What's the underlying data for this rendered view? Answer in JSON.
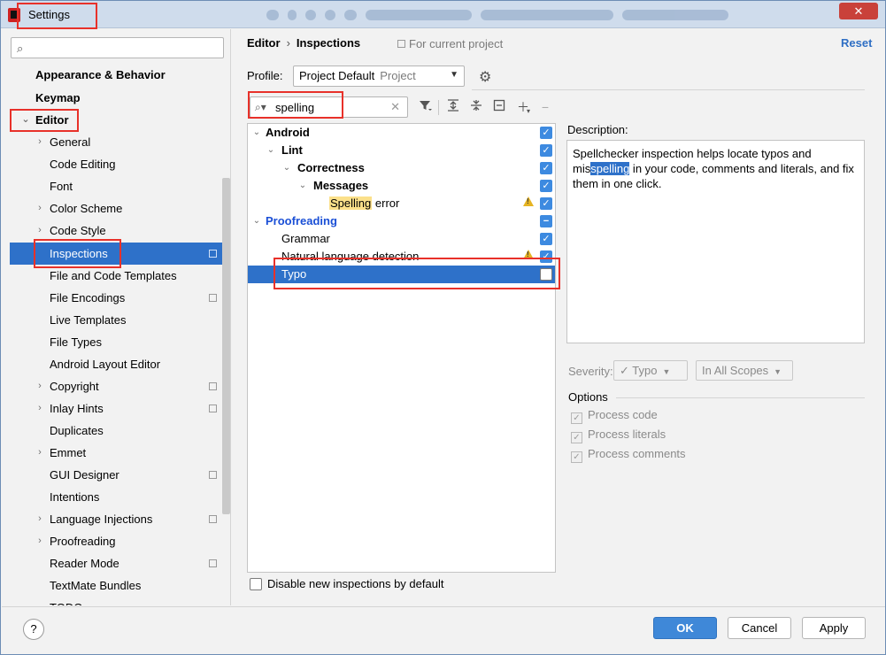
{
  "window": {
    "title": "Settings",
    "close": "✕"
  },
  "sidebar": {
    "search_placeholder": "",
    "items": [
      {
        "label": "Appearance & Behavior"
      },
      {
        "label": "Keymap"
      },
      {
        "label": "Editor",
        "arrow": "⌄"
      },
      {
        "label": "General",
        "arrow": "›"
      },
      {
        "label": "Code Editing"
      },
      {
        "label": "Font"
      },
      {
        "label": "Color Scheme",
        "arrow": "›"
      },
      {
        "label": "Code Style",
        "arrow": "›"
      },
      {
        "label": "Inspections"
      },
      {
        "label": "File and Code Templates"
      },
      {
        "label": "File Encodings"
      },
      {
        "label": "Live Templates"
      },
      {
        "label": "File Types"
      },
      {
        "label": "Android Layout Editor"
      },
      {
        "label": "Copyright",
        "arrow": "›"
      },
      {
        "label": "Inlay Hints",
        "arrow": "›"
      },
      {
        "label": "Duplicates"
      },
      {
        "label": "Emmet",
        "arrow": "›"
      },
      {
        "label": "GUI Designer"
      },
      {
        "label": "Intentions"
      },
      {
        "label": "Language Injections",
        "arrow": "›"
      },
      {
        "label": "Proofreading",
        "arrow": "›"
      },
      {
        "label": "Reader Mode"
      },
      {
        "label": "TextMate Bundles"
      },
      {
        "label": "TODO"
      }
    ]
  },
  "header": {
    "crumb1": "Editor",
    "sep": "›",
    "crumb2": "Inspections",
    "for_project": "For current project",
    "reset": "Reset"
  },
  "profile": {
    "label": "Profile:",
    "value": "Project Default",
    "scope": "Project"
  },
  "inspection_search": {
    "value": "spelling"
  },
  "tree": [
    {
      "label": "Android",
      "arrow": "⌄"
    },
    {
      "label": "Lint",
      "arrow": "⌄"
    },
    {
      "label": "Correctness",
      "arrow": "⌄"
    },
    {
      "label": "Messages",
      "arrow": "⌄"
    },
    {
      "label_hl": "Spelling",
      "label_rest": "error"
    },
    {
      "label": "Proofreading",
      "arrow": "⌄",
      "check": "−"
    },
    {
      "label": "Grammar"
    },
    {
      "label": "Natural language detection"
    },
    {
      "label": "Typo"
    }
  ],
  "check_mark": "✓",
  "description": {
    "label": "Description:",
    "part1": "Spellchecker inspection helps locate typos and mis",
    "selected": "spelling",
    "part2": " in your code, comments and literals, and fix them in one click."
  },
  "severity": {
    "label": "Severity:",
    "value": "✓ Typo",
    "scope": "In All Scopes"
  },
  "options": {
    "title": "Options",
    "items": [
      "Process code",
      "Process literals",
      "Process comments"
    ]
  },
  "disable_new": "Disable new inspections by default",
  "buttons": {
    "help": "?",
    "ok": "OK",
    "cancel": "Cancel",
    "apply": "Apply"
  },
  "colors": {
    "accent": "#2e71c9",
    "annotation": "#e8312a",
    "link": "#2f6fc4"
  }
}
